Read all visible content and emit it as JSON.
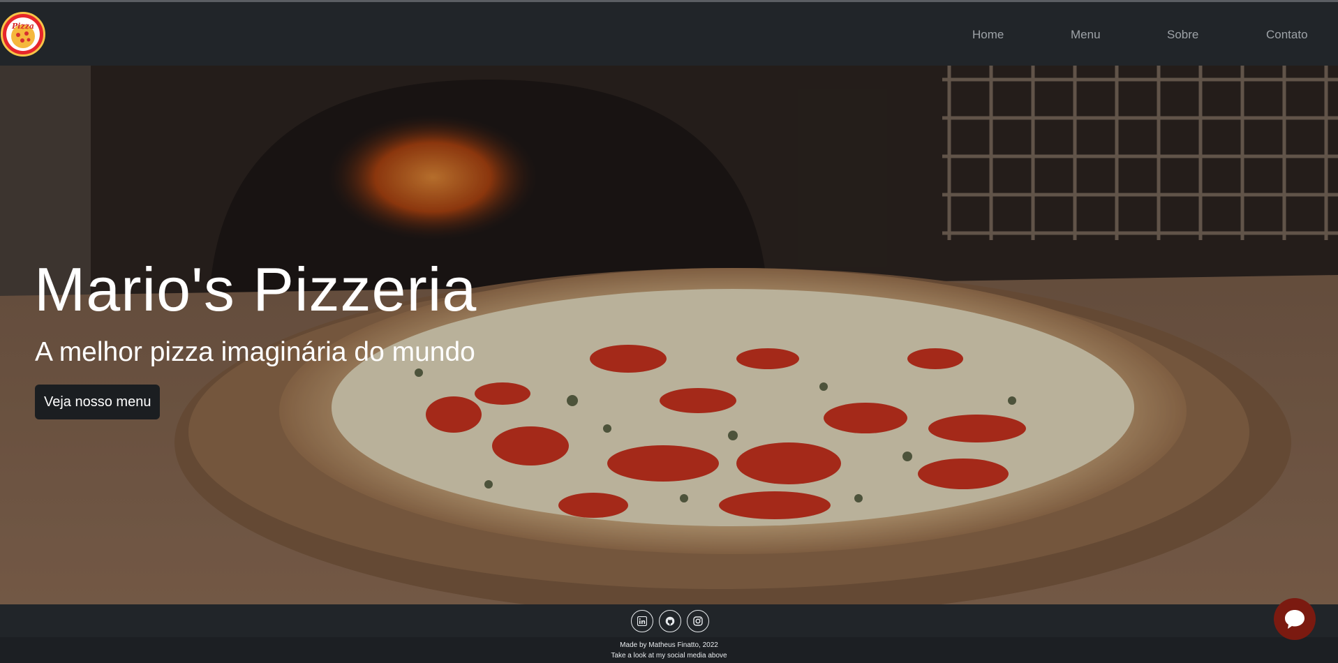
{
  "brand": {
    "logo_text": "Pizza"
  },
  "nav": {
    "items": [
      {
        "label": "Home"
      },
      {
        "label": "Menu"
      },
      {
        "label": "Sobre"
      },
      {
        "label": "Contato"
      }
    ]
  },
  "hero": {
    "title": "Mario's Pizzeria",
    "subtitle": "A melhor pizza imaginária do mundo",
    "cta_label": "Veja nosso menu"
  },
  "footer": {
    "social": [
      {
        "icon": "linkedin-icon"
      },
      {
        "icon": "github-icon"
      },
      {
        "icon": "instagram-icon"
      }
    ],
    "credit_line1": "Made by Matheus Finatto, 2022",
    "credit_line2": "Take a look at my social media above"
  },
  "colors": {
    "navbar": "#212529",
    "footer": "#212529",
    "chat_button": "#7b1a10",
    "logo_red": "#e6262b"
  },
  "chat": {
    "icon": "chat-bubble-icon"
  }
}
